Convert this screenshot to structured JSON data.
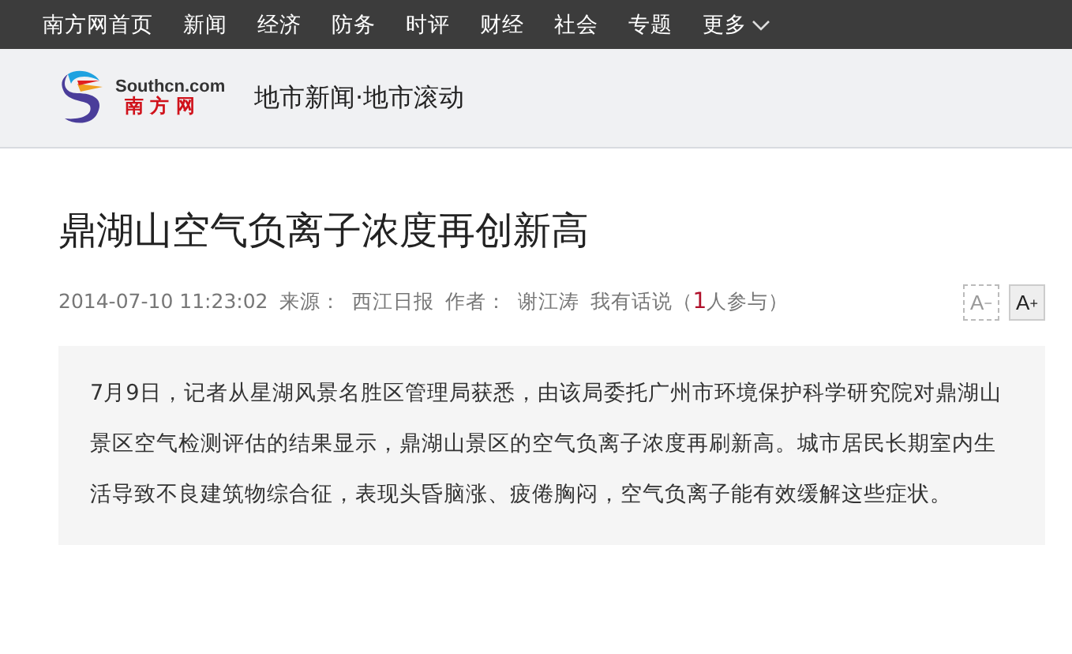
{
  "nav": {
    "items": [
      {
        "label": "南方网首页"
      },
      {
        "label": "新闻"
      },
      {
        "label": "经济"
      },
      {
        "label": "防务"
      },
      {
        "label": "时评"
      },
      {
        "label": "财经"
      },
      {
        "label": "社会"
      },
      {
        "label": "专题"
      }
    ],
    "more": "更多"
  },
  "header": {
    "logo_en": "Southcn.com",
    "logo_cn": "南 方 网",
    "channel": "地市新闻·地市滚动"
  },
  "article": {
    "title": "鼎湖山空气负离子浓度再创新高",
    "meta": {
      "datetime": "2014-07-10 11:23:02",
      "source_label": "来源：",
      "source": "西江日报",
      "author_label": "作者：",
      "author": "谢江涛",
      "comments_prefix": "我有话说（",
      "comments_count": "1",
      "comments_suffix": "人参与）"
    },
    "font_buttons": [
      {
        "label": "A",
        "sign": "−",
        "disabled": true
      },
      {
        "label": "A",
        "sign": "+",
        "disabled": false
      }
    ],
    "summary": "7月9日，记者从星湖风景名胜区管理局获悉，由该局委托广州市环境保护科学研究院对鼎湖山景区空气检测评估的结果显示，鼎湖山景区的空气负离子浓度再刷新高。城市居民长期室内生活导致不良建筑物综合征，表现头昏脑涨、疲倦胸闷，空气负离子能有效缓解这些症状。"
  }
}
